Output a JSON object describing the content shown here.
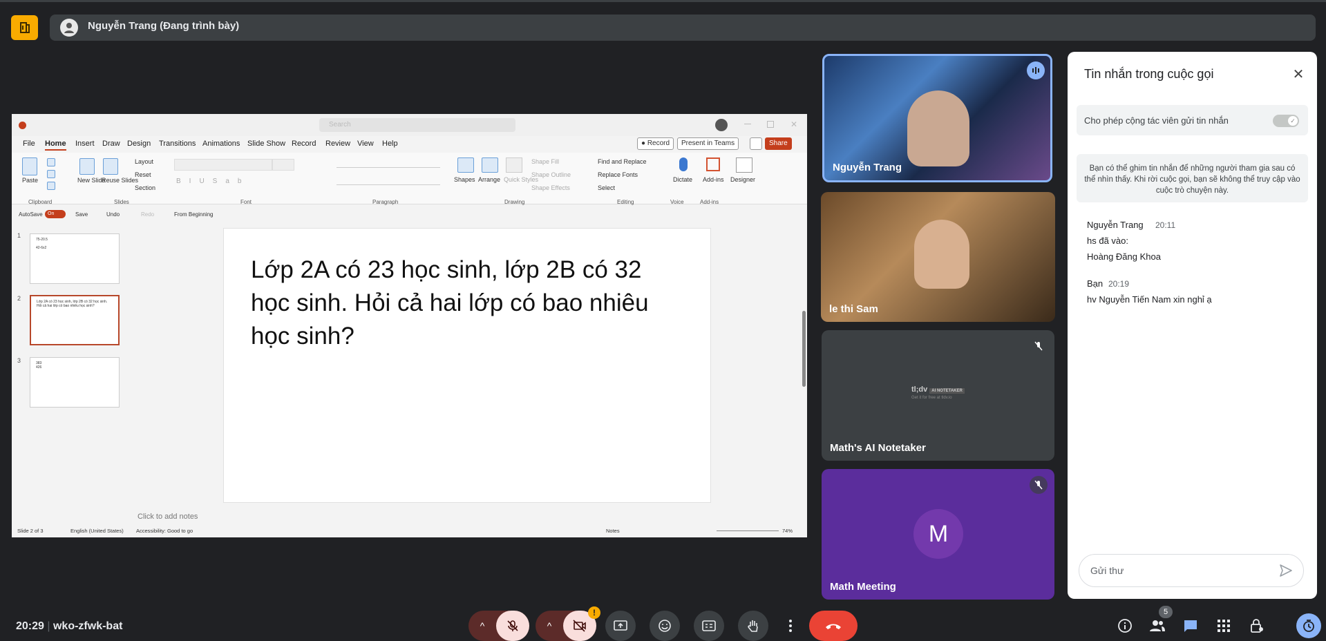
{
  "meeting": {
    "presenter_label": "Nguyễn Trang (Đang trình bày)",
    "time": "20:29",
    "meeting_code": "wko-zfwk-bat",
    "participant_count": "5"
  },
  "ppt": {
    "search_placeholder": "Search",
    "menu": [
      "File",
      "Home",
      "Insert",
      "Draw",
      "Design",
      "Transitions",
      "Animations",
      "Slide Show",
      "Record",
      "Review",
      "View",
      "Help"
    ],
    "record_label": "Record",
    "present_teams_label": "Present in Teams",
    "share_label": "Share",
    "ribbon": {
      "paste": "Paste",
      "new_slide": "New Slide",
      "reuse_slides": "Reuse Slides",
      "layout": "Layout",
      "reset": "Reset",
      "section": "Section",
      "shapes": "Shapes",
      "arrange": "Arrange",
      "quick_styles": "Quick Styles",
      "shape_fill": "Shape Fill",
      "shape_outline": "Shape Outline",
      "shape_effects": "Shape Effects",
      "find_replace": "Find and Replace",
      "replace_fonts": "Replace Fonts",
      "select": "Select",
      "dictate": "Dictate",
      "addins": "Add-ins",
      "designer": "Designer",
      "groups": [
        "Clipboard",
        "Slides",
        "Font",
        "Paragraph",
        "Drawing",
        "Editing",
        "Voice",
        "Add-ins"
      ]
    },
    "qat": {
      "autosave": "AutoSave",
      "autosave_state": "On",
      "save": "Save",
      "undo": "Undo",
      "redo": "Redo",
      "from_beginning": "From Beginning"
    },
    "thumbnails": [
      {
        "num": "1",
        "text": "75-20.5\n\n42-6x2"
      },
      {
        "num": "2",
        "text": "Lớp 2A có 23 học sinh, lớp 2B có 32 học sinh. Hỏi cả hai lớp có bao nhiêu học sinh?"
      },
      {
        "num": "3",
        "text": "383\n426"
      }
    ],
    "slide_text": "Lớp 2A có 23 học sinh, lớp 2B có 32 học sinh. Hỏi cả hai lớp có bao nhiêu học sinh?",
    "notes_hint": "Click to add notes",
    "status": {
      "slide_of": "Slide 2 of 3",
      "language": "English (United States)",
      "accessibility": "Accessibility: Good to go",
      "notes": "Notes",
      "zoom": "74%"
    }
  },
  "tiles": [
    {
      "name": "Nguyễn Trang"
    },
    {
      "name": "le thi Sam"
    },
    {
      "name": "Math's AI Notetaker",
      "logo": "tl;dv",
      "logo_tag": "AI NOTETAKER",
      "logo_sub": "Get it for free at tldv.io"
    },
    {
      "name": "Math Meeting",
      "initial": "M"
    }
  ],
  "chat": {
    "title": "Tin nhắn trong cuộc gọi",
    "toggle_label": "Cho phép cộng tác viên gửi tin nhắn",
    "info": "Bạn có thể ghim tin nhắn để những người tham gia sau có thể nhìn thấy. Khi rời cuộc gọi, bạn sẽ không thể truy cập vào cuộc trò chuyện này.",
    "messages": [
      {
        "sender": "Nguyễn Trang",
        "time": "20:11",
        "lines": [
          "hs đã vào:",
          "Hoàng Đăng Khoa"
        ]
      },
      {
        "sender": "Bạn",
        "time": "20:19",
        "lines": [
          "hv Nguyễn Tiến Nam xin nghỉ ạ"
        ]
      }
    ],
    "input_placeholder": "Gửi thư"
  },
  "colors": {
    "meet_bg": "#202124",
    "accent_yellow": "#f9ab00",
    "end_call_red": "#ea4335",
    "ppt_accent": "#c43e1c",
    "active_blue": "#8ab4f8"
  }
}
